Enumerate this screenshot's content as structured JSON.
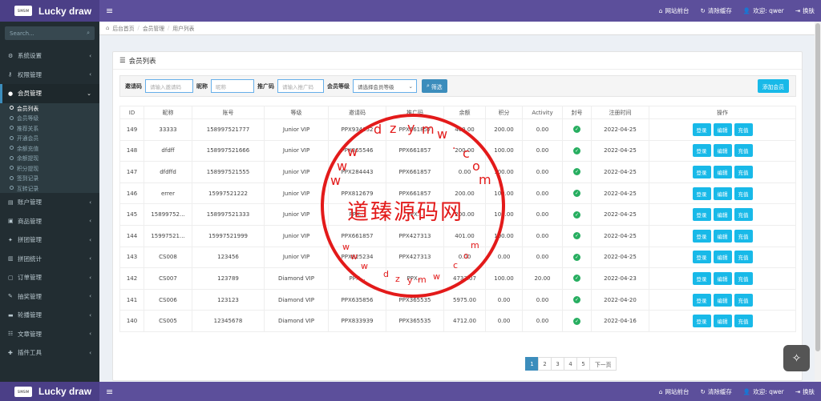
{
  "header": {
    "logo_box": "SIMSIM",
    "app_title": "Lucky draw",
    "menu_icon": "≡",
    "links": [
      {
        "icon": "home-icon",
        "label": "网站前台"
      },
      {
        "icon": "refresh-icon",
        "label": "清除缓存"
      },
      {
        "icon": "user-icon",
        "label": "欢迎: qwer"
      },
      {
        "icon": "logout-icon",
        "label": "换肤"
      }
    ]
  },
  "bottom_header": {
    "app_title": "Lucky draw",
    "links": [
      "网站前台",
      "清除缓存",
      "欢迎: qwer",
      "换肤"
    ]
  },
  "sidebar": {
    "search_placeholder": "Search...",
    "items_top": [
      {
        "label": "系统设置",
        "icon": "gear-icon"
      },
      {
        "label": "权限管理",
        "icon": "key-icon"
      }
    ],
    "open_item": {
      "label": "会员管理",
      "icon": "user-icon"
    },
    "sub_items": [
      {
        "label": "会员列表",
        "active": true
      },
      {
        "label": "会员等级",
        "active": false
      },
      {
        "label": "推荐关系",
        "active": false
      },
      {
        "label": "开通会员",
        "active": false
      },
      {
        "label": "余额充值",
        "active": false
      },
      {
        "label": "余额提现",
        "active": false
      },
      {
        "label": "积分提现",
        "active": false
      },
      {
        "label": "签到记录",
        "active": false
      },
      {
        "label": "互转记录",
        "active": false
      }
    ],
    "items_bottom": [
      {
        "label": "账户管理",
        "icon": "wallet-icon"
      },
      {
        "label": "商品管理",
        "icon": "box-icon"
      },
      {
        "label": "拼团管理",
        "icon": "group-icon"
      },
      {
        "label": "拼团统计",
        "icon": "chart-icon"
      },
      {
        "label": "订单管理",
        "icon": "order-icon"
      },
      {
        "label": "抽奖管理",
        "icon": "gift-icon"
      },
      {
        "label": "轮播管理",
        "icon": "image-icon"
      },
      {
        "label": "文章管理",
        "icon": "doc-icon"
      },
      {
        "label": "插件工具",
        "icon": "plug-icon"
      }
    ]
  },
  "breadcrumb": {
    "home": "后台首页",
    "level1": "会员管理",
    "level2": "用户列表"
  },
  "panel_title": "会员列表",
  "filter": {
    "invite_label": "邀请码",
    "invite_placeholder": "请输入邀请码",
    "nick_label": "昵称",
    "nick_placeholder": "昵称",
    "referrer_label": "推广码",
    "referrer_placeholder": "请输入推广码",
    "level_label": "会员等级",
    "level_placeholder": "请选择会员等级",
    "search_btn": "筛选",
    "add_btn": "添加会员"
  },
  "table": {
    "headers": [
      "ID",
      "昵称",
      "账号",
      "等级",
      "邀请码",
      "推广码",
      "余额",
      "积分",
      "Activity",
      "封号",
      "注册时间",
      "操作"
    ],
    "rows": [
      {
        "id": "149",
        "nick": "33333",
        "account": "158997521777",
        "level": "Junior VIP",
        "invite": "PPX934652",
        "ref": "PPX661857",
        "balance": "400.00",
        "points": "200.00",
        "activity": "0.00",
        "date": "2022-04-25"
      },
      {
        "id": "148",
        "nick": "dfdff",
        "account": "158997521666",
        "level": "Junior VIP",
        "invite": "PPX365546",
        "ref": "PPX661857",
        "balance": "200.00",
        "points": "100.00",
        "activity": "0.00",
        "date": "2022-04-25"
      },
      {
        "id": "147",
        "nick": "dfdffd",
        "account": "158997521555",
        "level": "Junior VIP",
        "invite": "PPX284443",
        "ref": "PPX661857",
        "balance": "0.00",
        "points": "100.00",
        "activity": "0.00",
        "date": "2022-04-25"
      },
      {
        "id": "146",
        "nick": "errer",
        "account": "15997521222",
        "level": "Junior VIP",
        "invite": "PPX812679",
        "ref": "PPX661857",
        "balance": "200.00",
        "points": "100.00",
        "activity": "0.00",
        "date": "2022-04-25"
      },
      {
        "id": "145",
        "nick": "15899752...",
        "account": "158997521333",
        "level": "Junior VIP",
        "invite": "PPX...",
        "ref": "PPX...",
        "balance": "200.00",
        "points": "100.00",
        "activity": "0.00",
        "date": "2022-04-25"
      },
      {
        "id": "144",
        "nick": "15997521...",
        "account": "15997521999",
        "level": "Junior VIP",
        "invite": "PPX661857",
        "ref": "PPX427313",
        "balance": "401.00",
        "points": "100.00",
        "activity": "0.00",
        "date": "2022-04-25"
      },
      {
        "id": "143",
        "nick": "CS008",
        "account": "123456",
        "level": "Junior VIP",
        "invite": "PPX825234",
        "ref": "PPX427313",
        "balance": "0.00",
        "points": "0.00",
        "activity": "0.00",
        "date": "2022-04-25"
      },
      {
        "id": "142",
        "nick": "CS007",
        "account": "123789",
        "level": "Diamond VIP",
        "invite": "PPX...",
        "ref": "PPX...",
        "balance": "4733.07",
        "points": "100.00",
        "activity": "20.00",
        "date": "2022-04-23"
      },
      {
        "id": "141",
        "nick": "CS006",
        "account": "123123",
        "level": "Diamond VIP",
        "invite": "PPX635856",
        "ref": "PPX365535",
        "balance": "5975.00",
        "points": "0.00",
        "activity": "0.00",
        "date": "2022-04-20"
      },
      {
        "id": "140",
        "nick": "CS005",
        "account": "12345678",
        "level": "Diamond VIP",
        "invite": "PPX833939",
        "ref": "PPX365535",
        "balance": "4712.00",
        "points": "0.00",
        "activity": "0.00",
        "date": "2022-04-16"
      }
    ],
    "ops": [
      "登录",
      "编辑",
      "充值"
    ]
  },
  "pagination": {
    "pages": [
      "1",
      "2",
      "3",
      "4",
      "5"
    ],
    "active": "1",
    "next": "下一页"
  },
  "watermark": {
    "text": "道臻源码网",
    "url": "www.dzym.com"
  },
  "colors": {
    "topbar": "#5c4f9b",
    "sidebar": "#222d32",
    "accent": "#18b9e8",
    "ok": "#27ae60",
    "watermark": "#e31a1a"
  }
}
